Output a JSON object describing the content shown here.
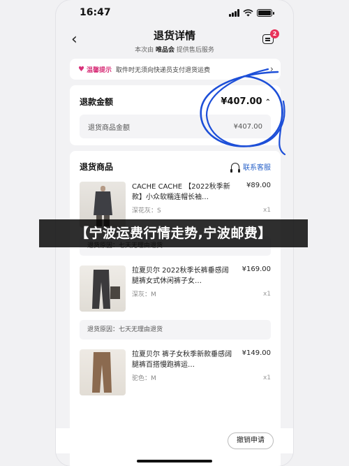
{
  "status": {
    "time": "16:47"
  },
  "nav": {
    "title": "退货详情",
    "subtitle_prefix": "本次由",
    "subtitle_brand": "唯品会",
    "subtitle_suffix": "提供售后服务",
    "badge_count": "2"
  },
  "tip": {
    "label": "温馨提示",
    "text": "取件时无须向快递员支付退货运费"
  },
  "refund": {
    "label": "退款金额",
    "amount": "¥407.00",
    "sub_label": "退货商品金额",
    "sub_amount": "¥407.00"
  },
  "goods": {
    "label": "退货商品",
    "service_label": "联系客服",
    "items": [
      {
        "name": "CACHE CACHE 【2022秋季新款】小众软糯连帽长袖…",
        "spec": "深花灰：S",
        "price": "¥89.00",
        "qty": "x1",
        "reason": "退货原因：七天无理由退货"
      },
      {
        "name": "拉夏贝尔 2022秋季长裤垂感阔腿裤女式休闲裤子女…",
        "spec": "深灰：M",
        "price": "¥169.00",
        "qty": "x1",
        "reason": "退货原因：七天无理由退货"
      },
      {
        "name": "拉夏贝尔 裤子女秋季新款垂感阔腿裤百搭慢跑裤运…",
        "spec": "驼色：M",
        "price": "¥149.00",
        "qty": "x1"
      }
    ]
  },
  "footer": {
    "cancel_label": "撤销申请"
  },
  "overlay": {
    "text": "【宁波运费行情走势,宁波邮费】"
  },
  "colors": {
    "accent_pink": "#d8327a",
    "link_blue": "#2a63c9",
    "badge_red": "#e8335a",
    "scribble_blue": "#1d4fd8"
  }
}
